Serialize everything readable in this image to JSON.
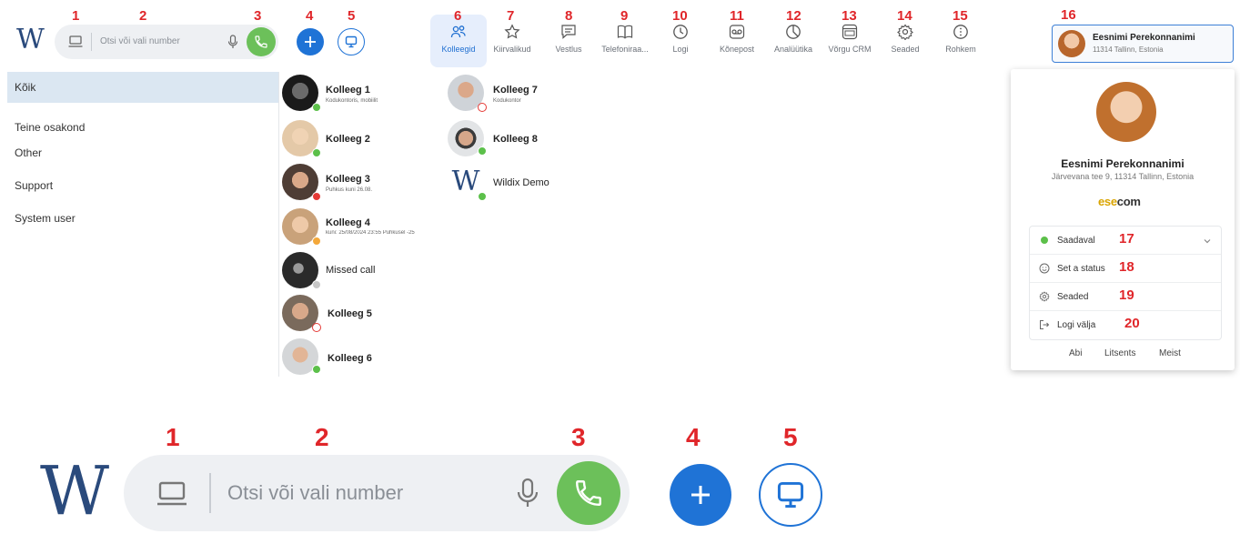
{
  "app": {
    "logo_letter": "W",
    "search_placeholder": "Otsi või vali number"
  },
  "callouts": [
    "1",
    "2",
    "3",
    "4",
    "5",
    "6",
    "7",
    "8",
    "9",
    "10",
    "11",
    "12",
    "13",
    "14",
    "15",
    "16",
    "17",
    "18",
    "19",
    "20"
  ],
  "nav_tabs": [
    {
      "label": "Kolleegid",
      "icon": "people-icon",
      "active": true
    },
    {
      "label": "Kiirvalikud",
      "icon": "star-icon"
    },
    {
      "label": "Vestlus",
      "icon": "chat-icon"
    },
    {
      "label": "Telefoniraa...",
      "icon": "book-icon"
    },
    {
      "label": "Logi",
      "icon": "clock-icon"
    },
    {
      "label": "Kõnepost",
      "icon": "voicemail-icon"
    },
    {
      "label": "Analüütika",
      "icon": "pie-chart-icon"
    },
    {
      "label": "Võrgu CRM",
      "icon": "crm-icon"
    },
    {
      "label": "Seaded",
      "icon": "gear-icon"
    },
    {
      "label": "Rohkem",
      "icon": "more-icon"
    }
  ],
  "user": {
    "name": "Eesnimi Perekonnanimi",
    "short_location": "11314 Tallinn, Estonia",
    "address": "Järvevana tee 9, 11314 Tallinn, Estonia",
    "brand_prefix": "ese",
    "brand_suffix": "com"
  },
  "groups": [
    {
      "label": "Kõik",
      "selected": true
    },
    {
      "label": "Teine osakond"
    },
    {
      "label": "Other"
    },
    {
      "label": "Support"
    },
    {
      "label": "System user"
    }
  ],
  "colleagues": [
    {
      "name": "Kolleeg 1",
      "status_text": "Kodukontoris, mobiilit",
      "status": "online"
    },
    {
      "name": "Kolleeg 2",
      "status_text": "",
      "status": "online"
    },
    {
      "name": "Kolleeg 3",
      "status_text": "Puhkus kuni 26.08.",
      "status": "busy"
    },
    {
      "name": "Kolleeg 4",
      "status_text": "kuni: 25/08/2024 23:55 Puhkusel -25",
      "status": "away"
    },
    {
      "name": "Missed call",
      "status_text": "",
      "status": "offline"
    },
    {
      "name": "Kolleeg 5",
      "status_text": "",
      "status": "call"
    },
    {
      "name": "Kolleeg 6",
      "status_text": "",
      "status": "online"
    },
    {
      "name": "Kolleeg 7",
      "status_text": "Kodukontor",
      "status": "call"
    },
    {
      "name": "Kolleeg 8",
      "status_text": "",
      "status": "online"
    },
    {
      "name": "Wildix Demo",
      "status_text": "",
      "status": "online"
    }
  ],
  "profile_menu": [
    {
      "label": "Saadaval",
      "icon": "green-dot-icon"
    },
    {
      "label": "Set a status",
      "icon": "smiley-icon"
    },
    {
      "label": "Seaded",
      "icon": "gear-icon"
    },
    {
      "label": "Logi välja",
      "icon": "logout-icon"
    }
  ],
  "footer_links": [
    "Abi",
    "Litsents",
    "Meist"
  ],
  "colors": {
    "accent": "#1f73d6",
    "call_green": "#6cc05a",
    "callout_red": "#e0262a",
    "online": "#5cc04a",
    "busy": "#e53935",
    "away": "#f4a83a",
    "offline": "#c7c7c7"
  }
}
